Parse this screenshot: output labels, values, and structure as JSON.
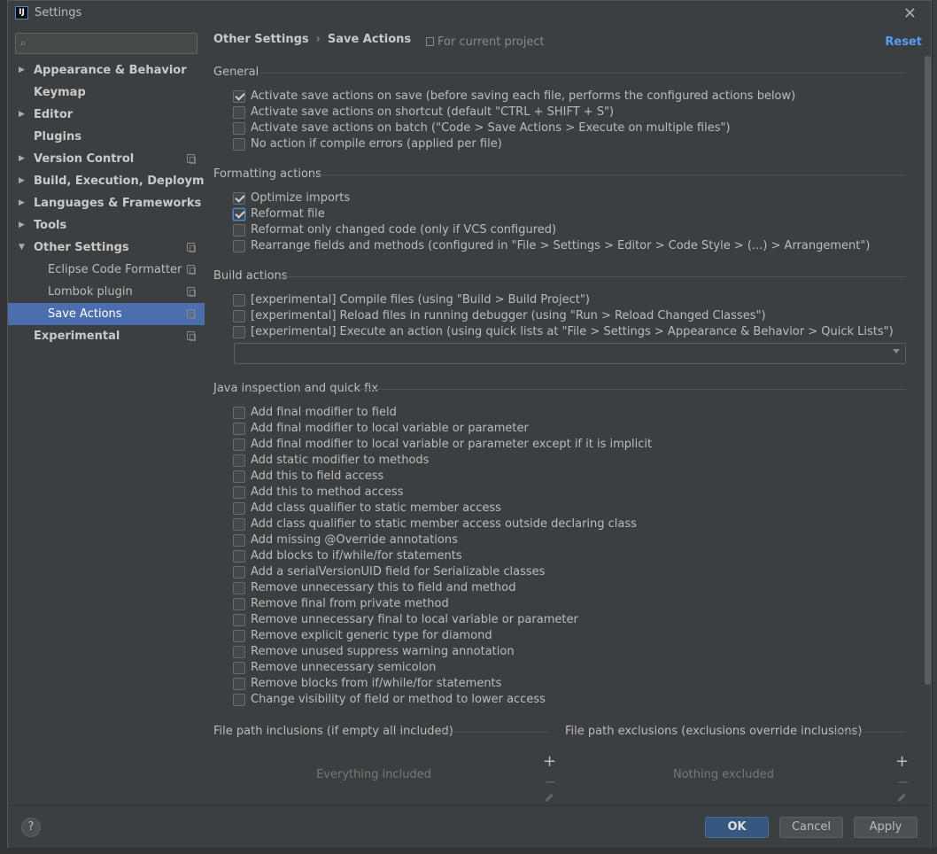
{
  "window": {
    "title": "Settings",
    "logo": "IJ"
  },
  "search": {
    "placeholder": ""
  },
  "sidebar": {
    "items": [
      {
        "label": "Appearance & Behavior",
        "arrow": "▶"
      },
      {
        "label": "Keymap"
      },
      {
        "label": "Editor",
        "arrow": "▶"
      },
      {
        "label": "Plugins"
      },
      {
        "label": "Version Control",
        "arrow": "▶"
      },
      {
        "label": "Build, Execution, Deployment",
        "arrow": "▶"
      },
      {
        "label": "Languages & Frameworks",
        "arrow": "▶"
      },
      {
        "label": "Tools",
        "arrow": "▶"
      },
      {
        "label": "Other Settings",
        "arrow": "▼"
      },
      {
        "label": "Eclipse Code Formatter"
      },
      {
        "label": "Lombok plugin"
      },
      {
        "label": "Save Actions"
      },
      {
        "label": "Experimental"
      }
    ]
  },
  "header": {
    "breadcrumb_parent": "Other Settings",
    "breadcrumb_sep": "›",
    "breadcrumb_current": "Save Actions",
    "scope": "For current project",
    "reset": "Reset"
  },
  "general": {
    "title": "General",
    "options": [
      {
        "label": "Activate save actions on save (before saving each file, performs the configured actions below)",
        "checked": true
      },
      {
        "label": "Activate save actions on shortcut (default \"CTRL + SHIFT + S\")",
        "checked": false
      },
      {
        "label": "Activate save actions on batch (\"Code > Save Actions > Execute on multiple files\")",
        "checked": false
      },
      {
        "label": "No action if compile errors (applied per file)",
        "checked": false
      }
    ]
  },
  "formatting": {
    "title": "Formatting actions",
    "options": [
      {
        "label": "Optimize imports",
        "checked": true
      },
      {
        "label": "Reformat file",
        "checked": true
      },
      {
        "label": "Reformat only changed code (only if VCS configured)",
        "checked": false
      },
      {
        "label": "Rearrange fields and methods (configured in \"File > Settings > Editor > Code Style > (...) > Arrangement\")",
        "checked": false
      }
    ]
  },
  "build": {
    "title": "Build actions",
    "options": [
      {
        "label": "[experimental] Compile files (using \"Build > Build Project\")",
        "checked": false
      },
      {
        "label": "[experimental] Reload files in running debugger (using \"Run > Reload Changed Classes\")",
        "checked": false
      },
      {
        "label": "[experimental] Execute an action (using quick lists at \"File > Settings > Appearance & Behavior > Quick Lists\")",
        "checked": false
      }
    ],
    "combo_value": ""
  },
  "java": {
    "title": "Java inspection and quick fix",
    "options": [
      "Add final modifier to field",
      "Add final modifier to local variable or parameter",
      "Add final modifier to local variable or parameter except if it is implicit",
      "Add static modifier to methods",
      "Add this to field access",
      "Add this to method access",
      "Add class qualifier to static member access",
      "Add class qualifier to static member access outside declaring class",
      "Add missing @Override annotations",
      "Add blocks to if/while/for statements",
      "Add a serialVersionUID field for Serializable classes",
      "Remove unnecessary this to field and method",
      "Remove final from private method",
      "Remove unnecessary final to local variable or parameter",
      "Remove explicit generic type for diamond",
      "Remove unused suppress warning annotation",
      "Remove unnecessary semicolon",
      "Remove blocks from if/while/for statements",
      "Change visibility of field or method to lower access"
    ]
  },
  "paths": {
    "inclusions_title": "File path inclusions (if empty all included)",
    "inclusions_empty": "Everything included",
    "exclusions_title": "File path exclusions (exclusions override inclusions)",
    "exclusions_empty": "Nothing excluded",
    "add_glyph": "+",
    "remove_glyph": "−"
  },
  "footer": {
    "help": "?",
    "ok": "OK",
    "cancel": "Cancel",
    "apply": "Apply"
  },
  "colors": {
    "selection": "#4b6eaf",
    "link": "#589df6",
    "primary_button": "#365880"
  },
  "icons": [
    "search-icon",
    "close-icon",
    "project-scope-icon",
    "dropdown-arrow-icon",
    "add-icon",
    "remove-icon",
    "edit-icon",
    "help-icon"
  ]
}
